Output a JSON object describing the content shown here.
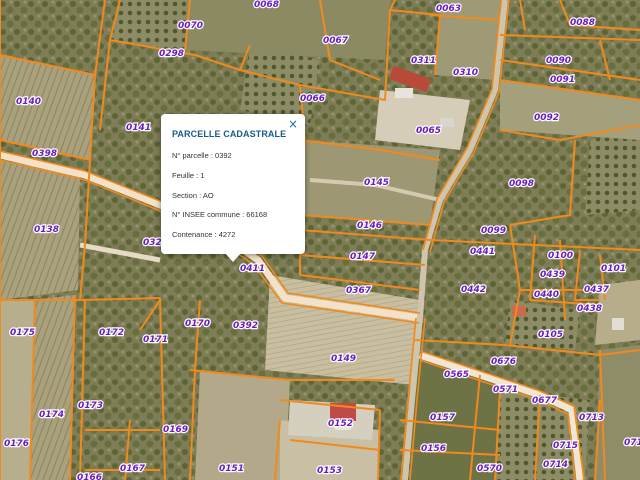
{
  "map": {
    "parcel_labels": [
      "0070",
      "0068",
      "0063",
      "0088",
      "0298",
      "0067",
      "0311",
      "0310",
      "0090",
      "0091",
      "0140",
      "0141",
      "0066",
      "0065",
      "0092",
      "0398",
      "0145",
      "0098",
      "0138",
      "0146",
      "0099",
      "0441",
      "0100",
      "0101",
      "032",
      "0411",
      "0147",
      "0439",
      "0437",
      "0367",
      "0442",
      "0440",
      "0438",
      "0175",
      "0172",
      "0170",
      "0392",
      "0105",
      "0171",
      "0149",
      "0676",
      "0565",
      "0571",
      "0677",
      "0174",
      "0173",
      "0169",
      "0152",
      "0157",
      "0713",
      "0176",
      "0156",
      "0715",
      "0166",
      "0167",
      "0151",
      "0153",
      "0570",
      "0714",
      "071"
    ],
    "colors": {
      "parcel_border": "#f08a1e",
      "label_text": "#6a1cc0",
      "road": "#f6dcc0"
    }
  },
  "popup": {
    "title": "PARCELLE CADASTRALE",
    "close_icon": "×",
    "rows": [
      {
        "key": "N° parcelle",
        "value": "0392"
      },
      {
        "key": "Feuille",
        "value": "1"
      },
      {
        "key": "Section",
        "value": "AO"
      },
      {
        "key": "N° INSEE commune",
        "value": "66168"
      },
      {
        "key": "Contenance",
        "value": "4272"
      }
    ],
    "separator": " : "
  }
}
